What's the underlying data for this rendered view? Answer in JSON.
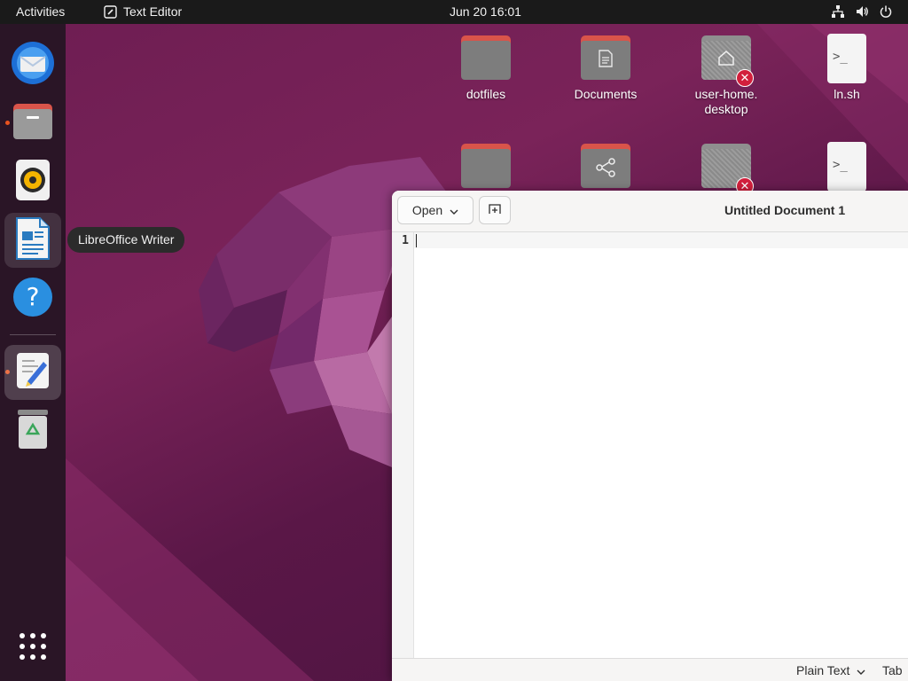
{
  "topbar": {
    "activities": "Activities",
    "app_name": "Text Editor",
    "clock": "Jun 20  16:01",
    "tray_icons": [
      "network-icon",
      "volume-icon",
      "power-icon"
    ]
  },
  "dock": {
    "items": [
      {
        "name": "thunderbird",
        "icon": "mail-icon",
        "running": false
      },
      {
        "name": "files",
        "icon": "folder-icon",
        "running": true
      },
      {
        "name": "rhythmbox",
        "icon": "speaker-icon",
        "running": false
      },
      {
        "name": "libreoffice-writer",
        "icon": "writer-icon",
        "running": false
      },
      {
        "name": "help",
        "icon": "help-icon",
        "running": false
      },
      {
        "name": "text-editor",
        "icon": "text-editor-icon",
        "running": true
      },
      {
        "name": "trash",
        "icon": "trash-icon",
        "running": false
      }
    ],
    "tooltip": "LibreOffice Writer"
  },
  "desktop": {
    "icons": [
      {
        "label": "dotfiles",
        "type": "folder"
      },
      {
        "label": "Documents",
        "type": "folder-documents"
      },
      {
        "label": "user-home.\ndesktop",
        "type": "broken-link-folder"
      },
      {
        "label": "ln.sh",
        "type": "script"
      }
    ],
    "second_row": [
      "folder",
      "shared-folder",
      "broken-link-folder",
      "script"
    ]
  },
  "editor": {
    "open_button": "Open",
    "title": "Untitled Document 1",
    "line_numbers": [
      "1"
    ],
    "content": "",
    "status_language": "Plain Text",
    "status_tab": "Tab"
  },
  "colors": {
    "accent": "#e9531f",
    "wallpaper": "#6d1d52",
    "topbar": "#1a1a1a"
  }
}
